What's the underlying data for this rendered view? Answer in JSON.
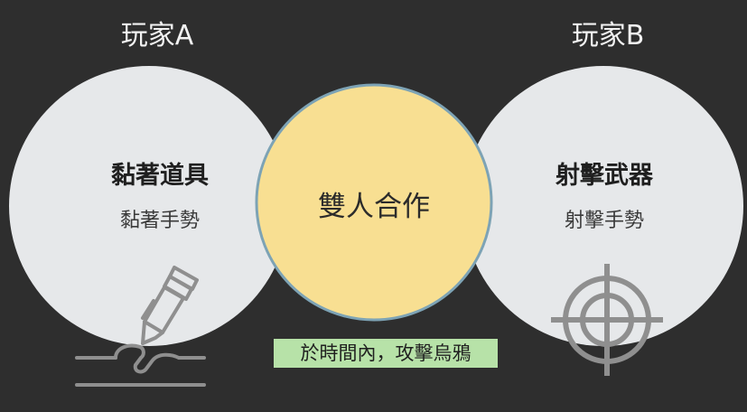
{
  "players": {
    "a": {
      "label": "玩家A",
      "title": "黏著道具",
      "subtitle": "黏著手勢"
    },
    "b": {
      "label": "玩家B",
      "title": "射擊武器",
      "subtitle": "射擊手勢"
    }
  },
  "center": {
    "label": "雙人合作"
  },
  "caption": "於時間內，攻擊烏鴉",
  "colors": {
    "background": "#2e2e2e",
    "side_circle": "#e6e8ea",
    "center_circle": "#f8df92",
    "center_stroke": "#7da3b5",
    "caption_bg": "#b7e2a8",
    "icon_gray": "#8f8f8f"
  },
  "icons": {
    "a": "glue-tube-icon",
    "b": "crosshair-icon"
  }
}
